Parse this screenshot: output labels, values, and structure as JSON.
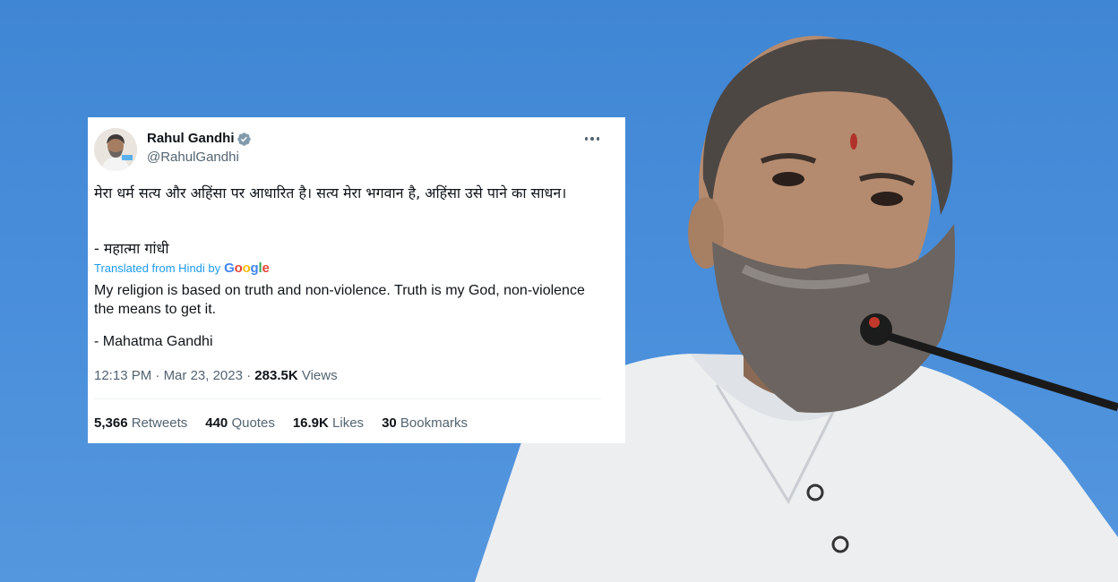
{
  "tweet": {
    "display_name": "Rahul Gandhi",
    "handle": "@RahulGandhi",
    "text_hindi": "मेरा धर्म सत्य और अहिंसा पर आधारित है। सत्य मेरा भगवान है, अहिंसा उसे पाने का साधन।",
    "signature_hindi": "- महात्मा गांधी",
    "translated_label": "Translated from Hindi by",
    "translator": {
      "G": "G",
      "o1": "o",
      "o2": "o",
      "g": "g",
      "l": "l",
      "e": "e"
    },
    "text_english": "My religion is based on truth and non-violence. Truth is my God, non-violence the means to get it.",
    "signature_english": "- Mahatma Gandhi",
    "time": "12:13 PM",
    "date": "Mar 23, 2023",
    "views_count": "283.5K",
    "views_label": "Views",
    "stats": {
      "retweets_count": "5,366",
      "retweets_label": "Retweets",
      "quotes_count": "440",
      "quotes_label": "Quotes",
      "likes_count": "16.9K",
      "likes_label": "Likes",
      "bookmarks_count": "30",
      "bookmarks_label": "Bookmarks"
    }
  },
  "colors": {
    "background": "#4a8fdb",
    "link_blue": "#1d9bf0",
    "secondary_text": "#536471",
    "primary_text": "#0f1419"
  },
  "icons": {
    "verified": "verified-badge-icon",
    "more": "more-horizontal-icon"
  }
}
